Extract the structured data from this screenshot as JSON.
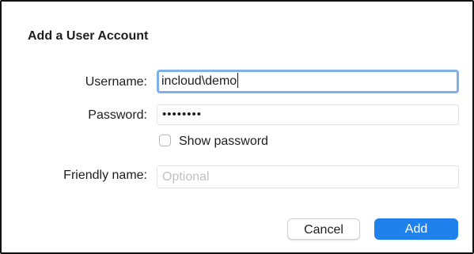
{
  "dialog": {
    "title": "Add a User Account"
  },
  "form": {
    "username_label": "Username:",
    "username_value": "incloud\\demo",
    "password_label": "Password:",
    "password_masked": "••••••••",
    "show_password_label": "Show password",
    "show_password_checked": false,
    "friendly_name_label": "Friendly name:",
    "friendly_name_value": "",
    "friendly_name_placeholder": "Optional"
  },
  "buttons": {
    "cancel_label": "Cancel",
    "add_label": "Add"
  },
  "colors": {
    "accent": "#1f82ec",
    "focus_ring": "#7fb1e8"
  }
}
